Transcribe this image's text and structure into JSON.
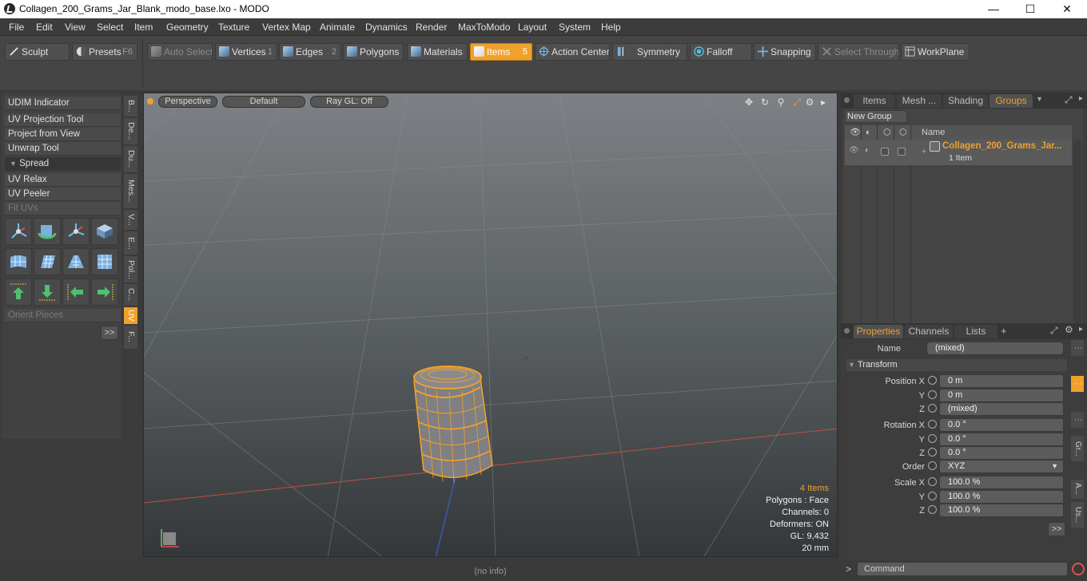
{
  "window": {
    "title": "Collagen_200_Grams_Jar_Blank_modo_base.lxo - MODO",
    "minimize": "—",
    "maximize": "☐",
    "close": "✕"
  },
  "menu": [
    "File",
    "Edit",
    "View",
    "Select",
    "Item",
    "Geometry",
    "Texture",
    "Vertex Map",
    "Animate",
    "Dynamics",
    "Render",
    "MaxToModo",
    "Layout",
    "System",
    "Help"
  ],
  "toolbar": {
    "sculpt": "Sculpt",
    "presets": "Presets",
    "presets_key": "F6",
    "auto_select": "Auto Select",
    "vertices": "Vertices",
    "vertices_key": "1",
    "edges": "Edges",
    "edges_key": "2",
    "polygons": "Polygons",
    "materials": "Materials",
    "items": "Items",
    "items_key": "5",
    "action_center": "Action Center",
    "symmetry": "Symmetry",
    "falloff": "Falloff",
    "snapping": "Snapping",
    "select_through": "Select Through",
    "workplane": "WorkPlane"
  },
  "left_panel": {
    "udim_indicator": "UDIM Indicator",
    "uv_projection_tool": "UV Projection Tool",
    "project_from_view": "Project from View",
    "unwrap_tool": "Unwrap Tool",
    "spread": "Spread",
    "uv_relax": "UV Relax",
    "uv_peeler": "UV Peeler",
    "fit_uvs": "Fit UVs",
    "orient_pieces": "Orient Pieces",
    "more": ">>",
    "vtabs": [
      "B...",
      "De...",
      "Du...",
      "Mes...",
      "V...",
      "E...",
      "Pol...",
      "C...",
      "UV",
      "F..."
    ]
  },
  "viewport": {
    "view_mode": "Perspective",
    "shading": "Default",
    "render": "Ray GL: Off",
    "info": {
      "items": "4 Items",
      "polygons": "Polygons : Face",
      "channels": "Channels: 0",
      "deformers": "Deformers: ON",
      "gl": "GL: 9,432",
      "unit": "20 mm"
    },
    "status": "(no info)"
  },
  "groups_panel": {
    "tabs": [
      "Items",
      "Mesh ...",
      "Shading",
      "Groups"
    ],
    "active_tab": "Groups",
    "new_group": "New Group",
    "column_name": "Name",
    "row_name": "Collagen_200_Grams_Jar...",
    "row_count": "1 Item"
  },
  "properties_panel": {
    "tabs": [
      "Properties",
      "Channels",
      "Lists"
    ],
    "add_tab": "+",
    "name_label": "Name",
    "name_value": "(mixed)",
    "transform_section": "Transform",
    "position_x_label": "Position X",
    "position_x": "0 m",
    "y_label": "Y",
    "z_label": "Z",
    "position_y": "0 m",
    "position_z": "(mixed)",
    "rotation_x_label": "Rotation X",
    "rotation_x": "0.0 °",
    "rotation_y": "0.0 °",
    "rotation_z": "0.0 °",
    "order_label": "Order",
    "order_value": "XYZ",
    "scale_x_label": "Scale X",
    "scale_x": "100.0 %",
    "scale_y": "100.0 %",
    "scale_z": "100.0 %",
    "more": ">>",
    "vtabs": [
      "Gr...",
      "A...",
      "Us..."
    ]
  },
  "command": {
    "prompt": ">",
    "placeholder": "Command"
  },
  "colors": {
    "accent": "#f0a12a",
    "panel": "#3d3d3d"
  }
}
